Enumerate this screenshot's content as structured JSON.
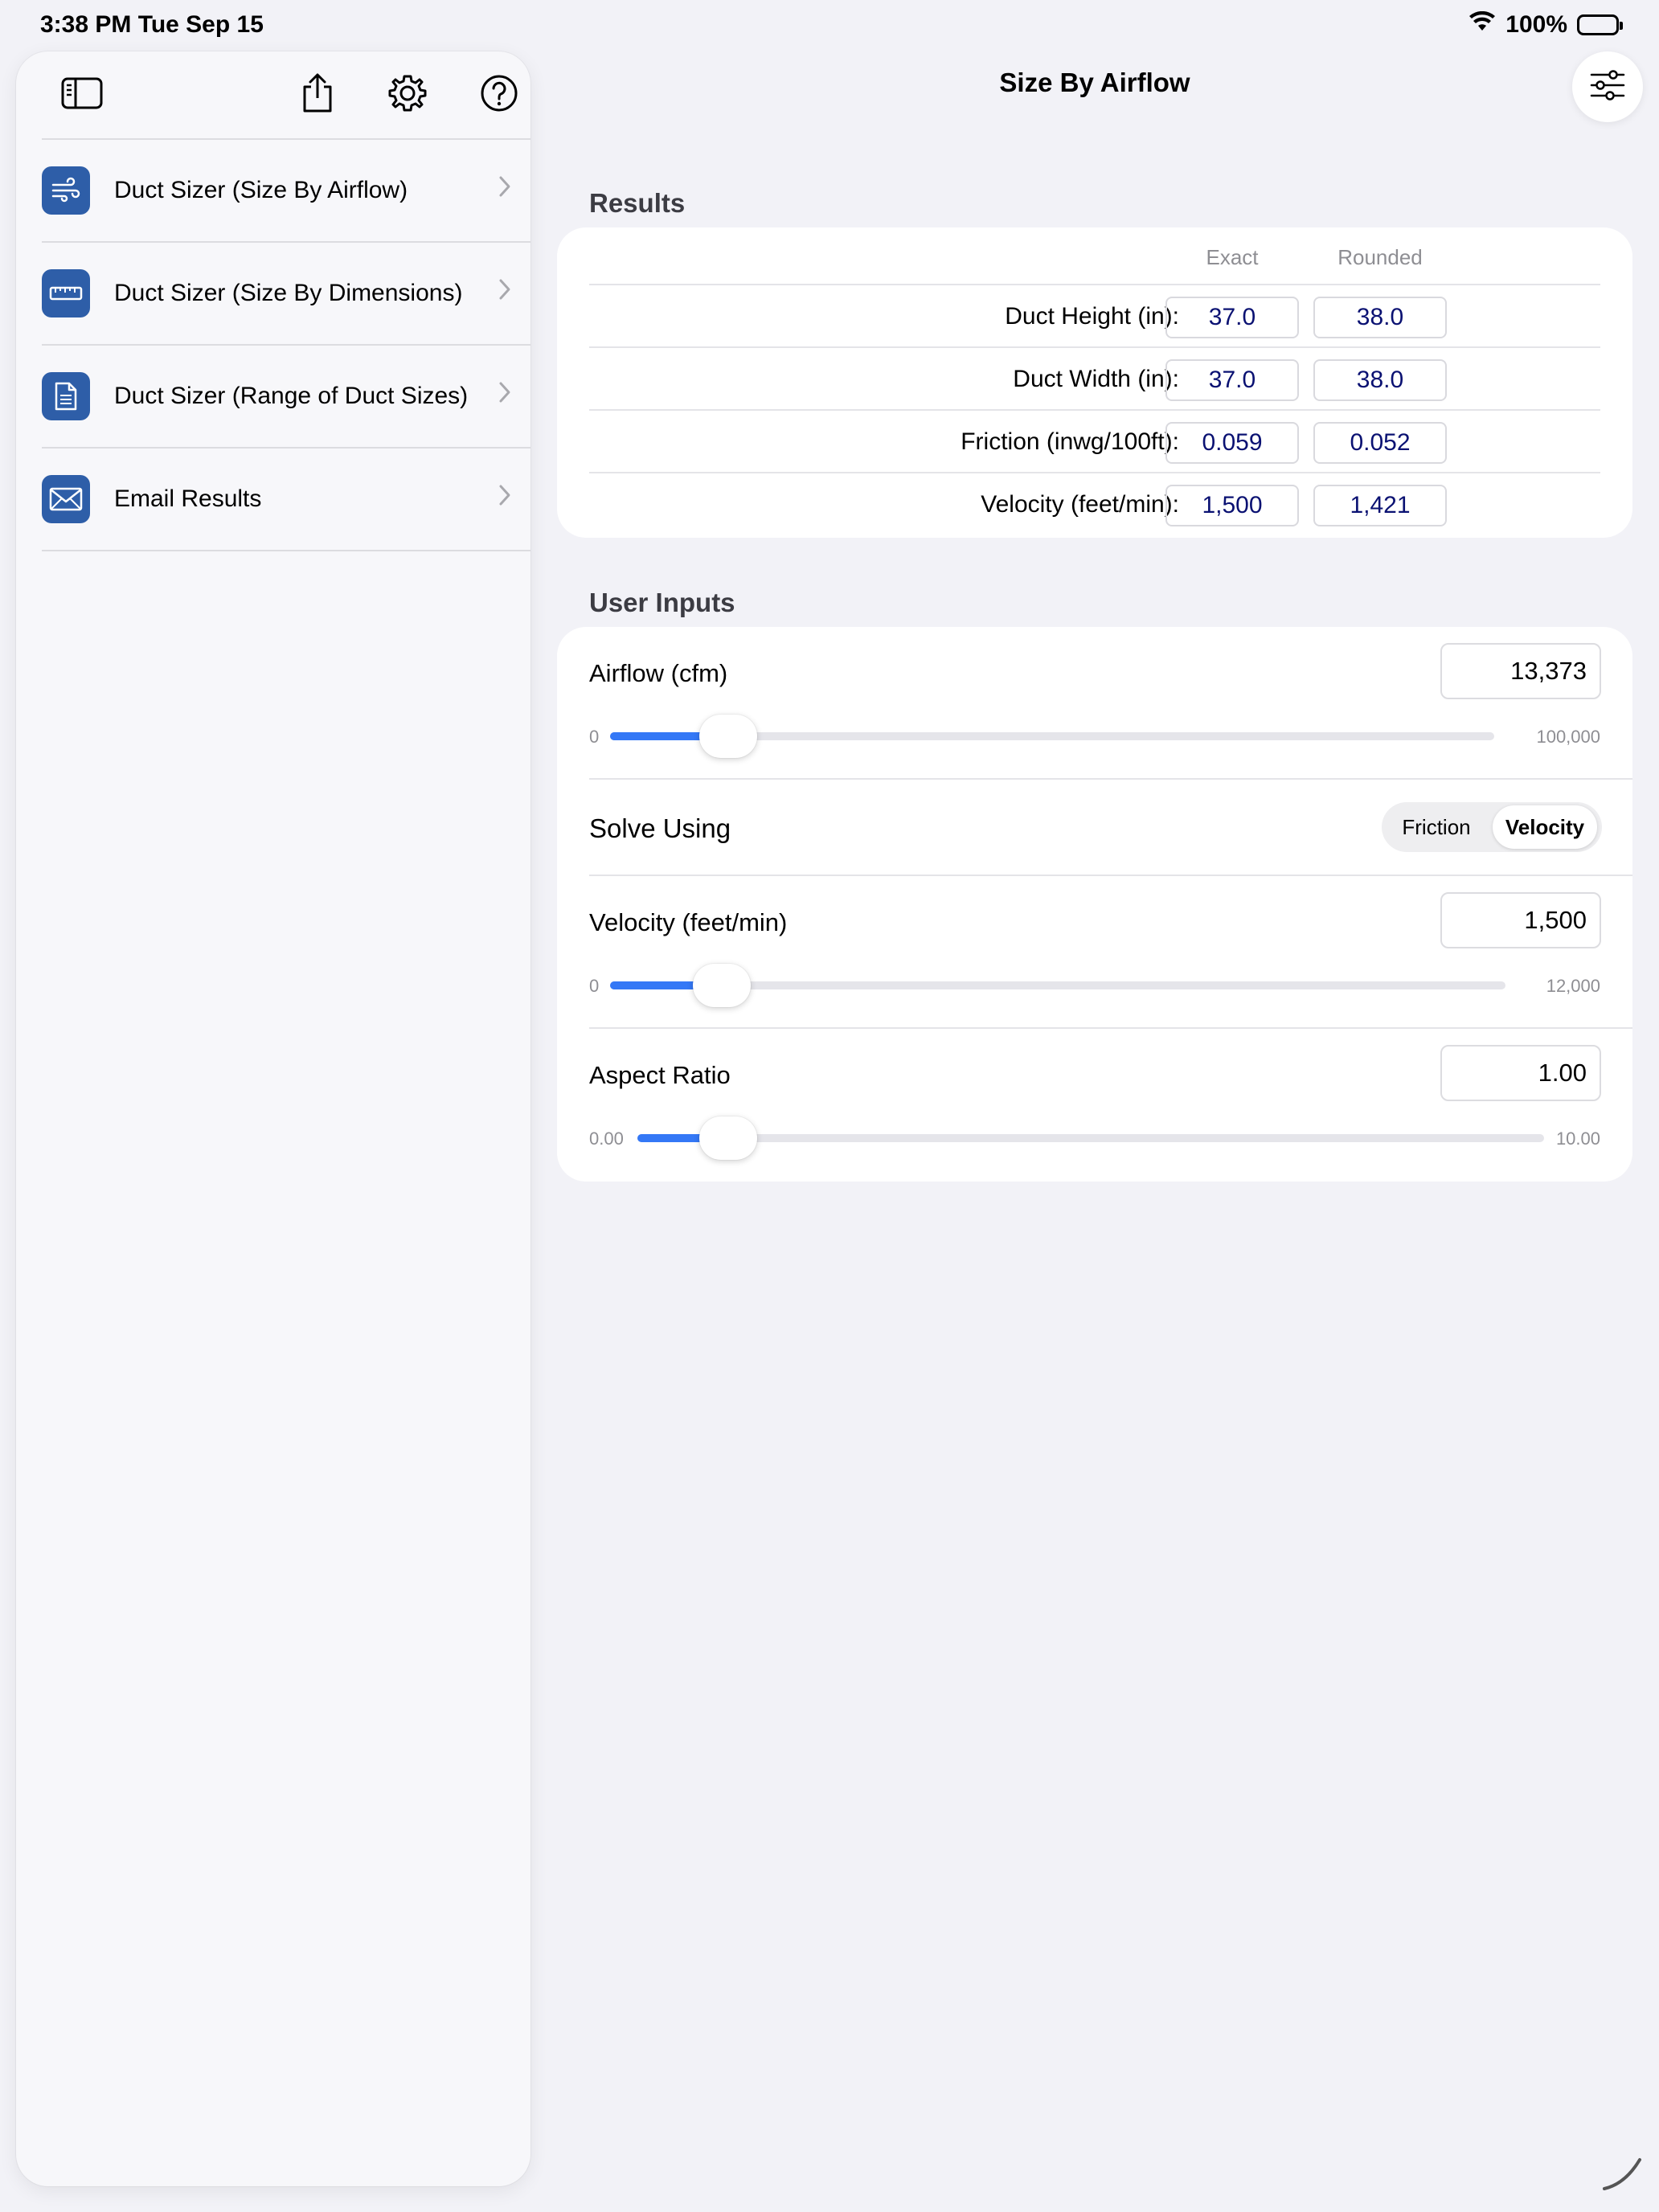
{
  "status_bar": {
    "time": "3:38 PM   Tue Sep 15",
    "battery": "100%"
  },
  "sidebar": {
    "toolbar": {
      "toggle_icon": "sidebar-toggle-icon",
      "share_icon": "share-icon",
      "settings_icon": "gear-icon",
      "help_icon": "help-circle-icon"
    },
    "items": [
      {
        "label": "Duct Sizer (Size By Airflow)",
        "icon": "wind-icon"
      },
      {
        "label": "Duct Sizer (Size By Dimensions)",
        "icon": "ruler-icon"
      },
      {
        "label": "Duct Sizer (Range of Duct Sizes)",
        "icon": "document-icon"
      },
      {
        "label": "Email Results",
        "icon": "envelope-icon"
      }
    ],
    "icon_color": "#2e5ea8"
  },
  "nav": {
    "title": "Size By Airflow",
    "options_icon": "sliders-icon"
  },
  "results": {
    "header": "Results",
    "columns": [
      "Exact",
      "Rounded"
    ],
    "rows": [
      {
        "label": "Duct Height (in):",
        "exact": "37.0",
        "rounded": "38.0"
      },
      {
        "label": "Duct Width (in):",
        "exact": "37.0",
        "rounded": "38.0"
      },
      {
        "label": "Friction (inwg/100ft):",
        "exact": "0.059",
        "rounded": "0.052"
      },
      {
        "label": "Velocity (feet/min):",
        "exact": "1,500",
        "rounded": "1,421"
      }
    ]
  },
  "inputs": {
    "header": "User Inputs",
    "airflow": {
      "label": "Airflow (cfm)",
      "value": "13,373",
      "min": "0",
      "max": "100,000",
      "fraction": 0.134
    },
    "solve_using": {
      "label": "Solve Using",
      "options": [
        "Friction",
        "Velocity"
      ],
      "selected": "Velocity"
    },
    "velocity": {
      "label": "Velocity (feet/min)",
      "value": "1,500",
      "min": "0",
      "max": "12,000",
      "fraction": 0.125
    },
    "aspect_ratio": {
      "label": "Aspect Ratio",
      "value": "1.00",
      "min": "0.00",
      "max": "10.00",
      "fraction": 0.1
    }
  },
  "colors": {
    "accent": "#3478f6",
    "result_text": "#0a1172",
    "background": "#f2f2f7"
  }
}
